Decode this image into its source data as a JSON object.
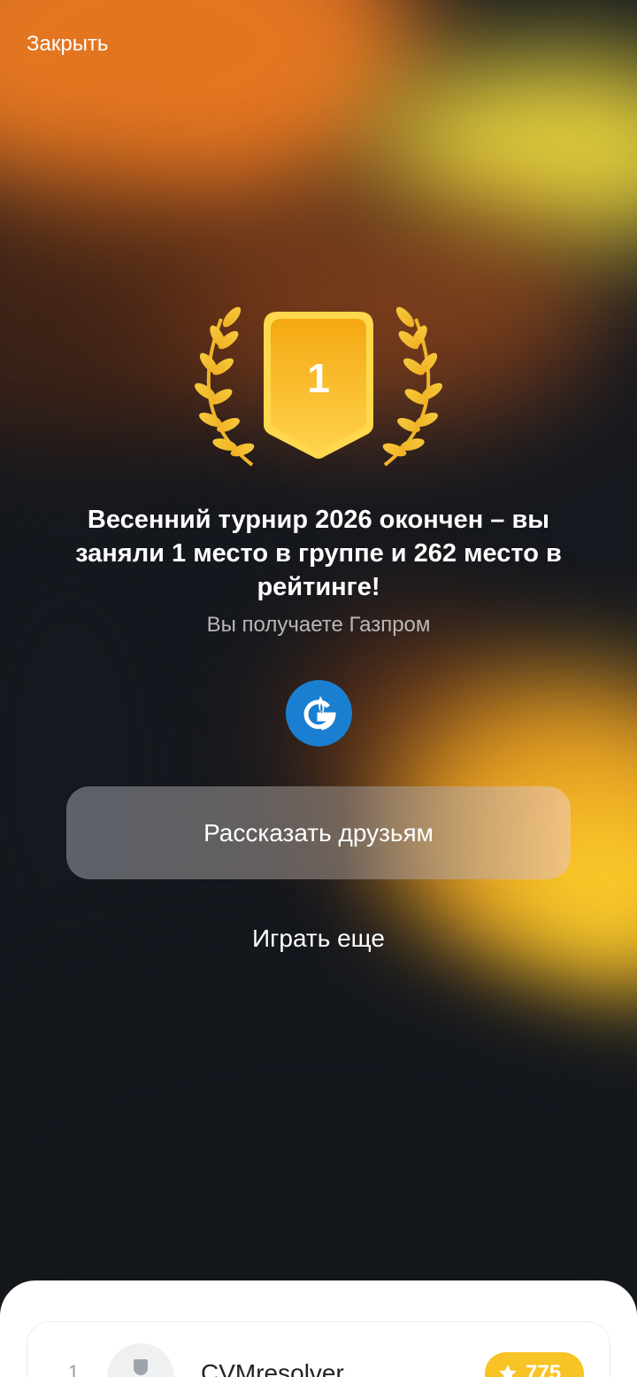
{
  "header": {
    "close_label": "Закрыть"
  },
  "badge": {
    "place": "1"
  },
  "result": {
    "title": "Весенний турнир 2026 окончен – вы заняли 1 место в группе и 262 место в рейтинге!",
    "subtitle": "Вы получаете Газпром",
    "reward_icon": "gazprom-logo"
  },
  "actions": {
    "share_label": "Рассказать друзьям",
    "play_again_label": "Играть еще"
  },
  "leaderboard": {
    "rows": [
      {
        "rank": "1",
        "name": "CVMresolver",
        "score": "775",
        "icon": "star-icon"
      }
    ]
  },
  "colors": {
    "gold": "#f8c425",
    "gazprom_blue": "#1a7fd1",
    "background_dark": "#14171d",
    "orange": "#ef7b22"
  }
}
